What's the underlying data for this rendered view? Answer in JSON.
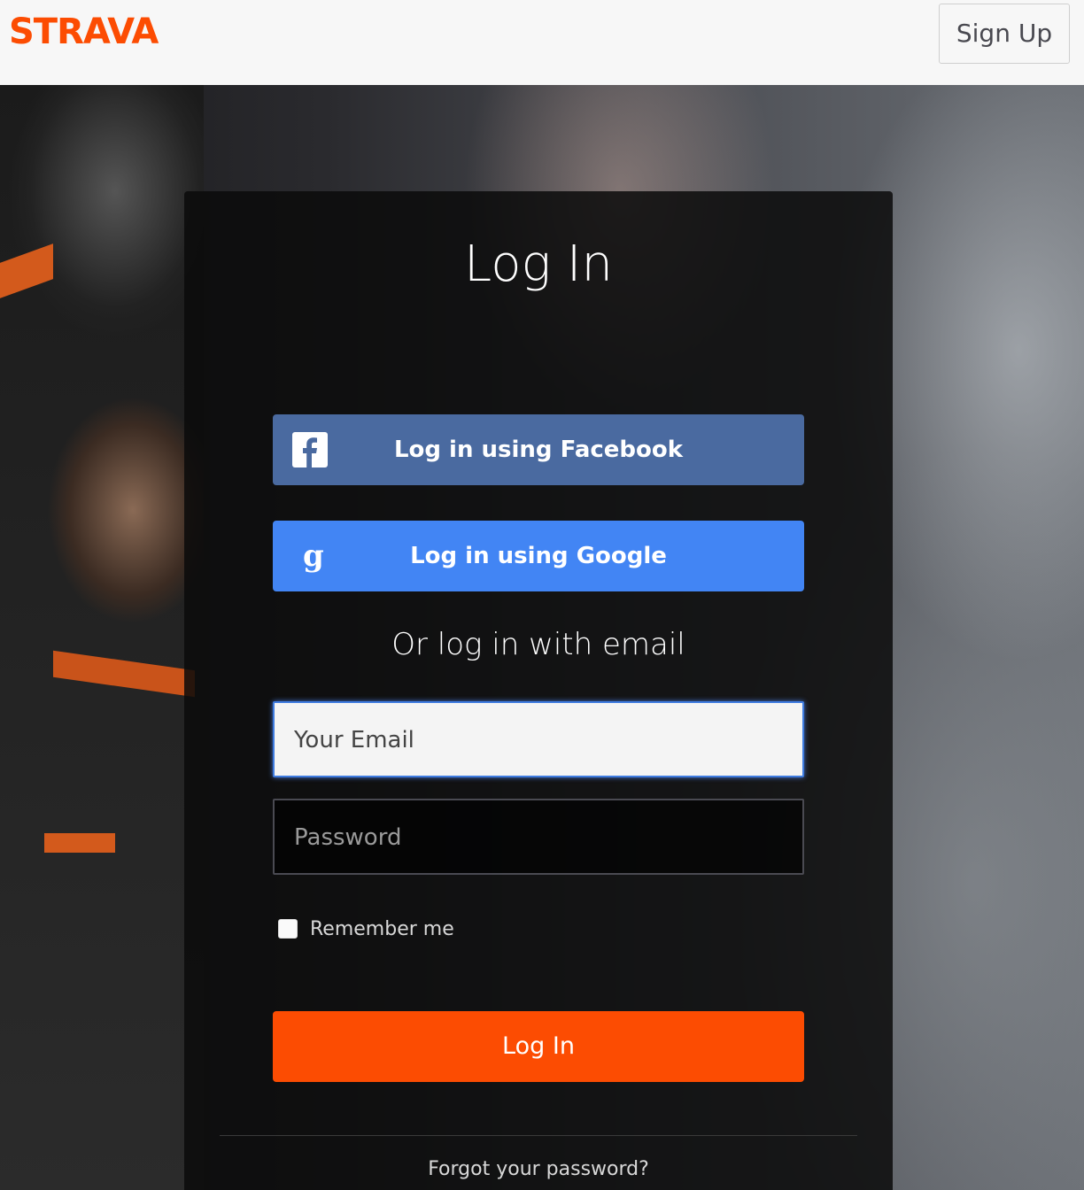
{
  "header": {
    "logo_text": "STRAVA",
    "signup_label": "Sign Up"
  },
  "login": {
    "title": "Log In",
    "facebook_label": "Log in using Facebook",
    "google_label": "Log in using Google",
    "or_text": "Or log in with email",
    "email_placeholder": "Your Email",
    "password_placeholder": "Password",
    "remember_label": "Remember me",
    "remember_checked": false,
    "submit_label": "Log In",
    "forgot_label": "Forgot your password?"
  },
  "icons": {
    "facebook": "facebook-icon",
    "google": "google-icon"
  },
  "colors": {
    "brand_orange": "#fc4c02",
    "facebook_blue": "#4a6aa0",
    "google_blue": "#4285f4"
  }
}
